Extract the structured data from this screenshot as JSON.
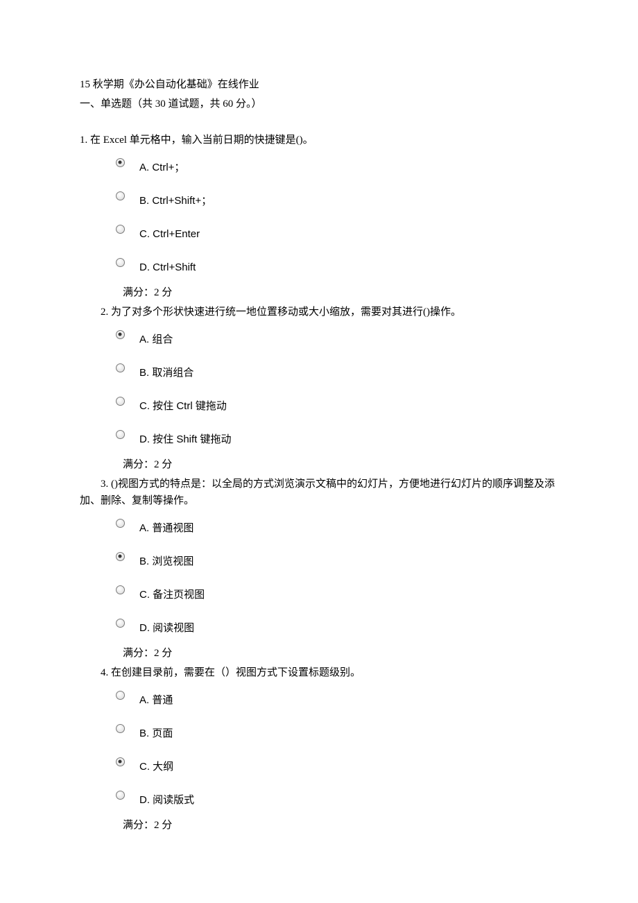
{
  "header": {
    "line1": "15 秋学期《办公自动化基础》在线作业",
    "line2": "一、单选题（共 30 道试题，共 60 分。）"
  },
  "score_text": "满分：2 分",
  "questions": [
    {
      "number": "1.",
      "stem": "  在 Excel 单元格中，输入当前日期的快捷键是()。",
      "indent": "indent0",
      "options": [
        {
          "label": "A. Ctrl+；",
          "checked": true
        },
        {
          "label": "B. Ctrl+Shift+；",
          "checked": false
        },
        {
          "label": "C. Ctrl+Enter",
          "checked": false
        },
        {
          "label": "D. Ctrl+Shift",
          "checked": false
        }
      ]
    },
    {
      "number": "2.",
      "stem": "  为了对多个形状快速进行统一地位置移动或大小缩放，需要对其进行()操作。",
      "indent": "indent1",
      "options": [
        {
          "label": "A. 组合",
          "checked": true
        },
        {
          "label": "B. 取消组合",
          "checked": false
        },
        {
          "label": "C. 按住 Ctrl 键拖动",
          "checked": false
        },
        {
          "label": "D. 按住 Shift 键拖动",
          "checked": false
        }
      ]
    },
    {
      "number": "3.",
      "stem": "  ()视图方式的特点是：以全局的方式浏览演示文稿中的幻灯片，方便地进行幻灯片的顺序调整及添加、删除、复制等操作。",
      "indent": "indent1",
      "wrap": true,
      "options": [
        {
          "label": "A. 普通视图",
          "checked": false
        },
        {
          "label": "B. 浏览视图",
          "checked": true
        },
        {
          "label": "C. 备注页视图",
          "checked": false
        },
        {
          "label": "D. 阅读视图",
          "checked": false
        }
      ]
    },
    {
      "number": "4.",
      "stem": "  在创建目录前，需要在（）视图方式下设置标题级别。",
      "indent": "indent1",
      "options": [
        {
          "label": "A. 普通",
          "checked": false
        },
        {
          "label": "B. 页面",
          "checked": false
        },
        {
          "label": "C. 大纲",
          "checked": true
        },
        {
          "label": "D. 阅读版式",
          "checked": false
        }
      ]
    }
  ]
}
